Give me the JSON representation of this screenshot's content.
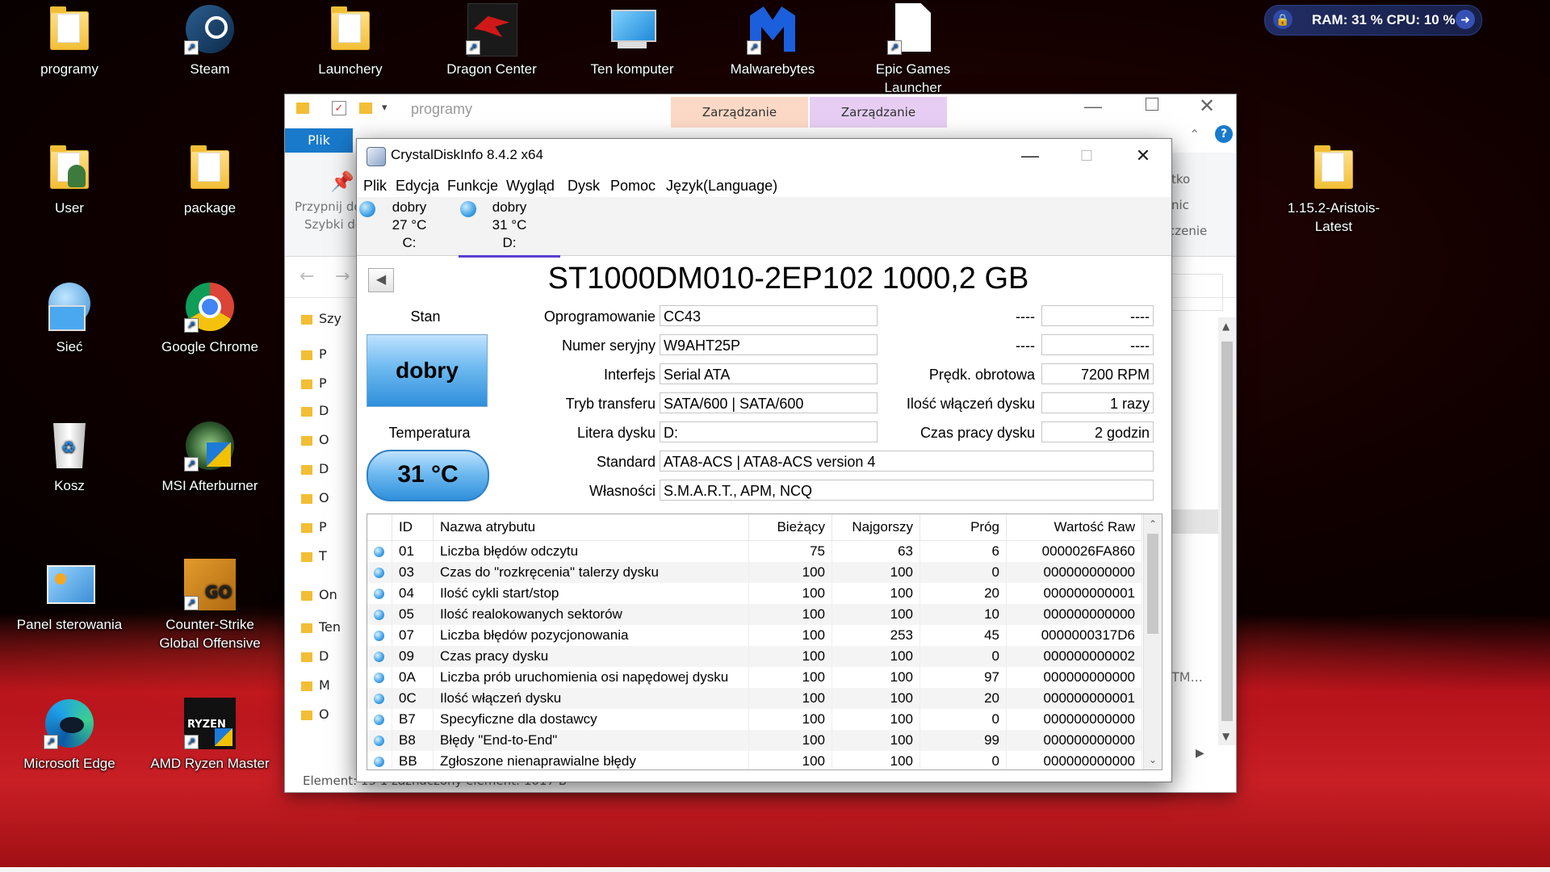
{
  "desktop_icons": [
    {
      "label": "programy",
      "icon": "folder-icon"
    },
    {
      "label": "Steam",
      "icon": "steam-icon"
    },
    {
      "label": "Launchery",
      "icon": "folder-icon"
    },
    {
      "label": "Dragon Center",
      "icon": "dragon-center-icon"
    },
    {
      "label": "Ten komputer",
      "icon": "computer-icon"
    },
    {
      "label": "Malwarebytes",
      "icon": "malwarebytes-icon"
    },
    {
      "label": "Epic Games Launcher",
      "icon": "file-icon"
    },
    {
      "label": "User",
      "icon": "user-folder-icon"
    },
    {
      "label": "package",
      "icon": "folder-icon"
    },
    {
      "label": "1.15.2-Aristois-Latest",
      "icon": "folder-icon"
    },
    {
      "label": "Sieć",
      "icon": "network-icon"
    },
    {
      "label": "Google Chrome",
      "icon": "chrome-icon"
    },
    {
      "label": "Kosz",
      "icon": "recycle-bin-icon"
    },
    {
      "label": "MSI Afterburner",
      "icon": "afterburner-icon"
    },
    {
      "label": "Panel sterowania",
      "icon": "control-panel-icon"
    },
    {
      "label": "Counter-Strike Global Offensive",
      "icon": "csgo-icon"
    },
    {
      "label": "Microsoft Edge",
      "icon": "edge-icon"
    },
    {
      "label": "AMD Ryzen Master",
      "icon": "ryzen-icon"
    }
  ],
  "tray_widget": {
    "text": "RAM: 31 % CPU: 10 %"
  },
  "explorer": {
    "title": "programy",
    "tab_manage_1": "Zarządzanie",
    "tab_manage_2": "Zarządzanie",
    "file_tab": "Plik",
    "pin_label_1": "Przypnij do",
    "pin_label_2": "Szybki do",
    "right_ribbon_1": "tko",
    "right_ribbon_2": "nic",
    "right_ribbon_3": "czenie",
    "sidebar": [
      "Szy",
      "P",
      "P",
      "D",
      "O",
      "D",
      "O",
      "P",
      "T",
      "On",
      "Ten",
      "D",
      "M",
      "O"
    ],
    "right_list_tail": "TM...",
    "status": "Element: 15     1 zaznaczony element: 1017 B"
  },
  "cdi": {
    "title": "CrystalDiskInfo 8.4.2 x64",
    "menu": [
      "Plik",
      "Edycja",
      "Funkcje",
      "Wygląd",
      "Dysk",
      "Pomoc",
      "Język(Language)"
    ],
    "disks": [
      {
        "status": "dobry",
        "temp": "27 °C",
        "letter": "C:"
      },
      {
        "status": "dobry",
        "temp": "31 °C",
        "letter": "D:"
      }
    ],
    "model": "ST1000DM010-2EP102 1000,2 GB",
    "stan_label": "Stan",
    "health": "dobry",
    "temp_label": "Temperatura",
    "temp": "31 °C",
    "fields": {
      "firmware_label": "Oprogramowanie",
      "firmware": "CC43",
      "serial_label": "Numer seryjny",
      "serial": "W9AHT25P",
      "interface_label": "Interfejs",
      "interface": "Serial ATA",
      "transfer_label": "Tryb transferu",
      "transfer": "SATA/600 | SATA/600",
      "letter_label": "Litera dysku",
      "letter": "D:",
      "standard_label": "Standard",
      "standard": "ATA8-ACS | ATA8-ACS version 4",
      "features_label": "Własności",
      "features": "S.M.A.R.T., APM, NCQ",
      "r1_label": "----",
      "r1_value": "----",
      "r2_label": "----",
      "r2_value": "----",
      "rpm_label": "Prędk. obrotowa",
      "rpm": "7200 RPM",
      "powercount_label": "Ilość włączeń dysku",
      "powercount": "1 razy",
      "hours_label": "Czas pracy dysku",
      "hours": "2 godzin"
    },
    "smart_headers": [
      "ID",
      "Nazwa atrybutu",
      "Bieżący",
      "Najgorszy",
      "Próg",
      "Wartość Raw"
    ],
    "smart_rows": [
      [
        "01",
        "Liczba błędów odczytu",
        "75",
        "63",
        "6",
        "0000026FA860"
      ],
      [
        "03",
        "Czas do \"rozkręcenia\" talerzy dysku",
        "100",
        "100",
        "0",
        "000000000000"
      ],
      [
        "04",
        "Ilość cykli start/stop",
        "100",
        "100",
        "20",
        "000000000001"
      ],
      [
        "05",
        "Ilość realokowanych sektorów",
        "100",
        "100",
        "10",
        "000000000000"
      ],
      [
        "07",
        "Liczba błędów pozycjonowania",
        "100",
        "253",
        "45",
        "0000000317D6"
      ],
      [
        "09",
        "Czas pracy dysku",
        "100",
        "100",
        "0",
        "000000000002"
      ],
      [
        "0A",
        "Liczba prób uruchomienia osi napędowej dysku",
        "100",
        "100",
        "97",
        "000000000000"
      ],
      [
        "0C",
        "Ilość włączeń dysku",
        "100",
        "100",
        "20",
        "000000000001"
      ],
      [
        "B7",
        "Specyficzne dla dostawcy",
        "100",
        "100",
        "0",
        "000000000000"
      ],
      [
        "B8",
        "Błędy \"End-to-End\"",
        "100",
        "100",
        "99",
        "000000000000"
      ],
      [
        "BB",
        "Zgłoszone nienaprawialne błędy",
        "100",
        "100",
        "0",
        "000000000000"
      ]
    ]
  }
}
